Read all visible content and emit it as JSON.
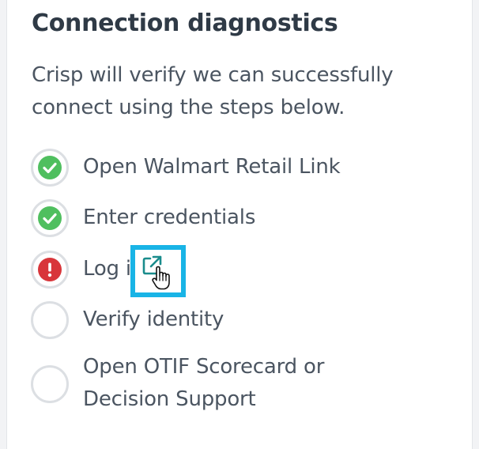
{
  "panel": {
    "title": "Connection diagnostics",
    "description": "Crisp will verify we can successfully connect using the steps below."
  },
  "steps": [
    {
      "label": "Open Walmart Retail Link",
      "status": "success",
      "icon": "check-icon"
    },
    {
      "label": "Enter credentials",
      "status": "success",
      "icon": "check-icon"
    },
    {
      "label": "Log in",
      "status": "error",
      "icon": "exclamation-icon"
    },
    {
      "label": "Verify identity",
      "status": "pending",
      "icon": "empty-circle-icon"
    },
    {
      "label": "Open OTIF Scorecard or Decision Support",
      "status": "pending",
      "icon": "empty-circle-icon"
    }
  ],
  "colors": {
    "success": "#4fbf5f",
    "error": "#d8353a",
    "highlight": "#19b4e6",
    "link": "#1a8c8c",
    "text": "#4b5561",
    "title": "#2f3a46"
  },
  "icons": {
    "external_link": "external-link-icon",
    "cursor": "hand-pointer-icon"
  }
}
